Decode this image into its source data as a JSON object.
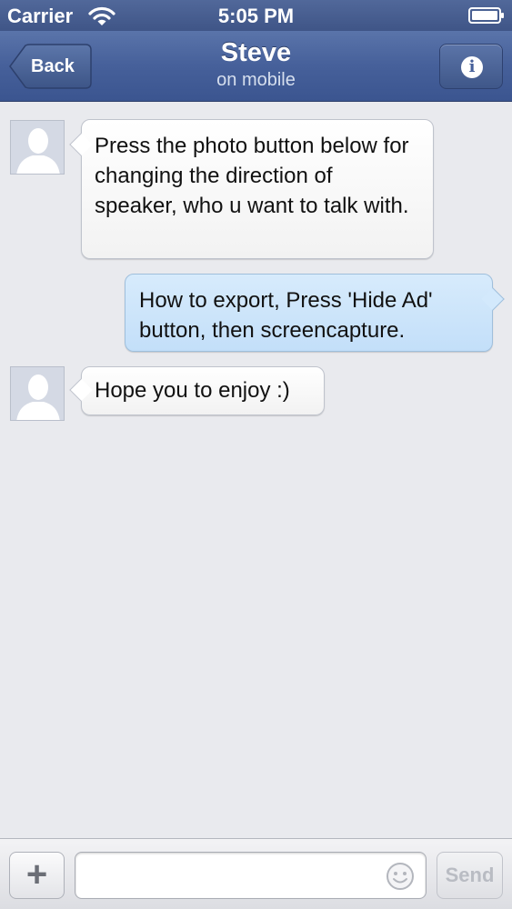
{
  "status_bar": {
    "carrier": "Carrier",
    "time": "5:05 PM",
    "wifi_icon": "wifi-icon",
    "battery_icon": "battery-icon"
  },
  "nav": {
    "back_label": "Back",
    "title": "Steve",
    "subtitle": "on mobile",
    "info_icon": "info-icon",
    "info_glyph": "i"
  },
  "messages": [
    {
      "direction": "incoming",
      "text": "Press the photo button below for changing the direction of speaker, who u want to talk with."
    },
    {
      "direction": "outgoing",
      "text": "How to export, Press 'Hide Ad' button, then screencapture."
    },
    {
      "direction": "incoming",
      "text": "Hope you to enjoy :)"
    }
  ],
  "toolbar": {
    "add_glyph": "+",
    "input_value": "",
    "input_placeholder": "",
    "smiley_icon": "smiley-icon",
    "send_label": "Send"
  },
  "colors": {
    "nav_bar": "#46609a",
    "background": "#e9eaee",
    "incoming_bubble": "#ffffff",
    "outgoing_bubble": "#c9e2fa"
  }
}
